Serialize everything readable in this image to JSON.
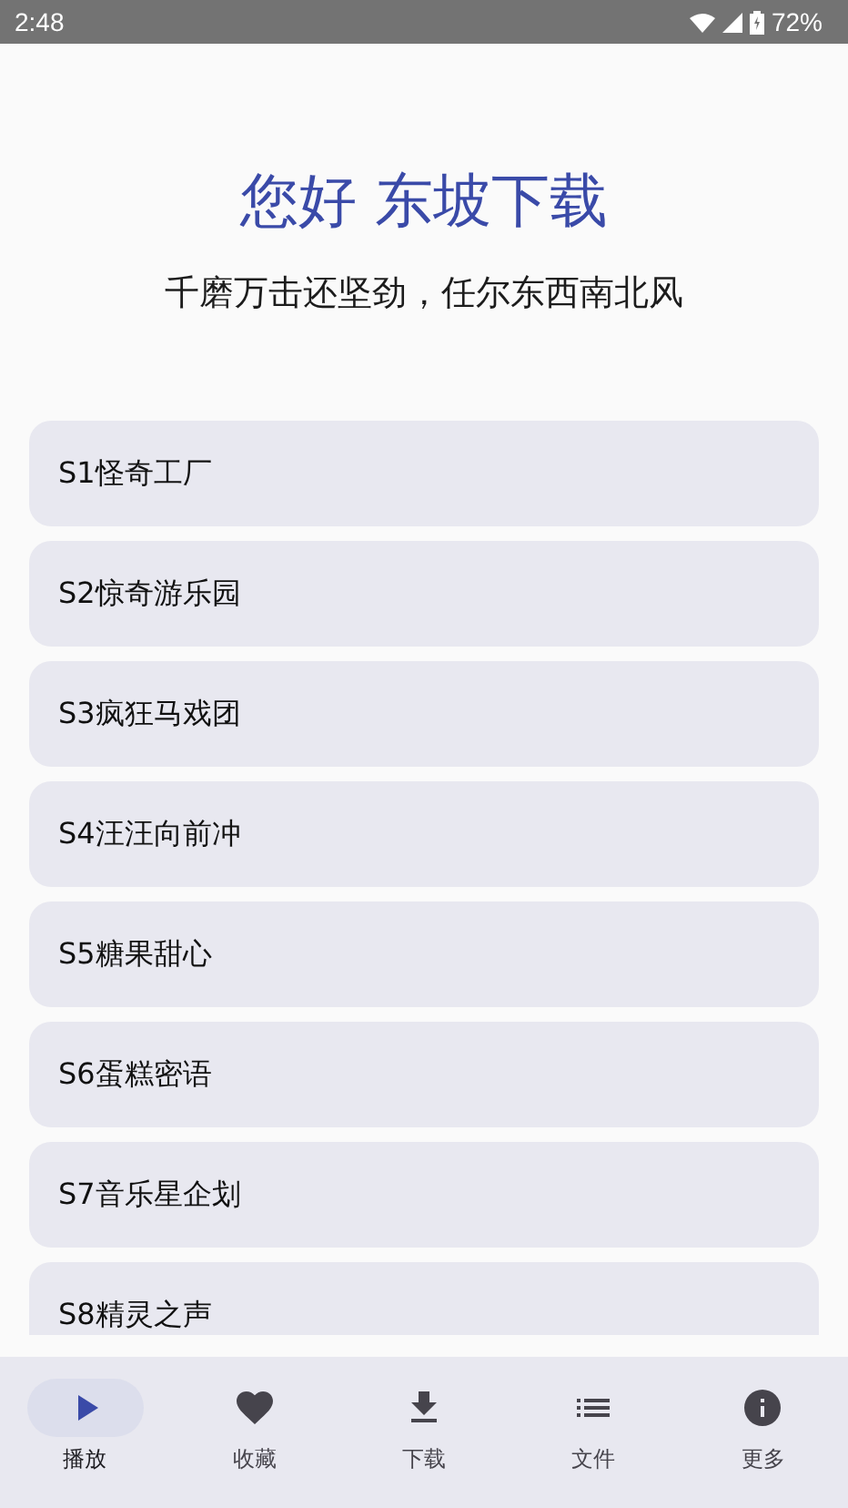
{
  "status_bar": {
    "time": "2:48",
    "battery": "72%"
  },
  "header": {
    "title": "您好 东坡下载",
    "subtitle": "千磨万击还坚劲，任尔东西南北风"
  },
  "episodes": [
    {
      "label": "S1怪奇工厂"
    },
    {
      "label": "S2惊奇游乐园"
    },
    {
      "label": "S3疯狂马戏团"
    },
    {
      "label": "S4汪汪向前冲"
    },
    {
      "label": "S5糖果甜心"
    },
    {
      "label": "S6蛋糕密语"
    },
    {
      "label": "S7音乐星企划"
    },
    {
      "label": "S8精灵之声"
    }
  ],
  "bottom_nav": [
    {
      "label": "播放",
      "selected": true
    },
    {
      "label": "收藏",
      "selected": false
    },
    {
      "label": "下载",
      "selected": false
    },
    {
      "label": "文件",
      "selected": false
    },
    {
      "label": "更多",
      "selected": false
    }
  ]
}
